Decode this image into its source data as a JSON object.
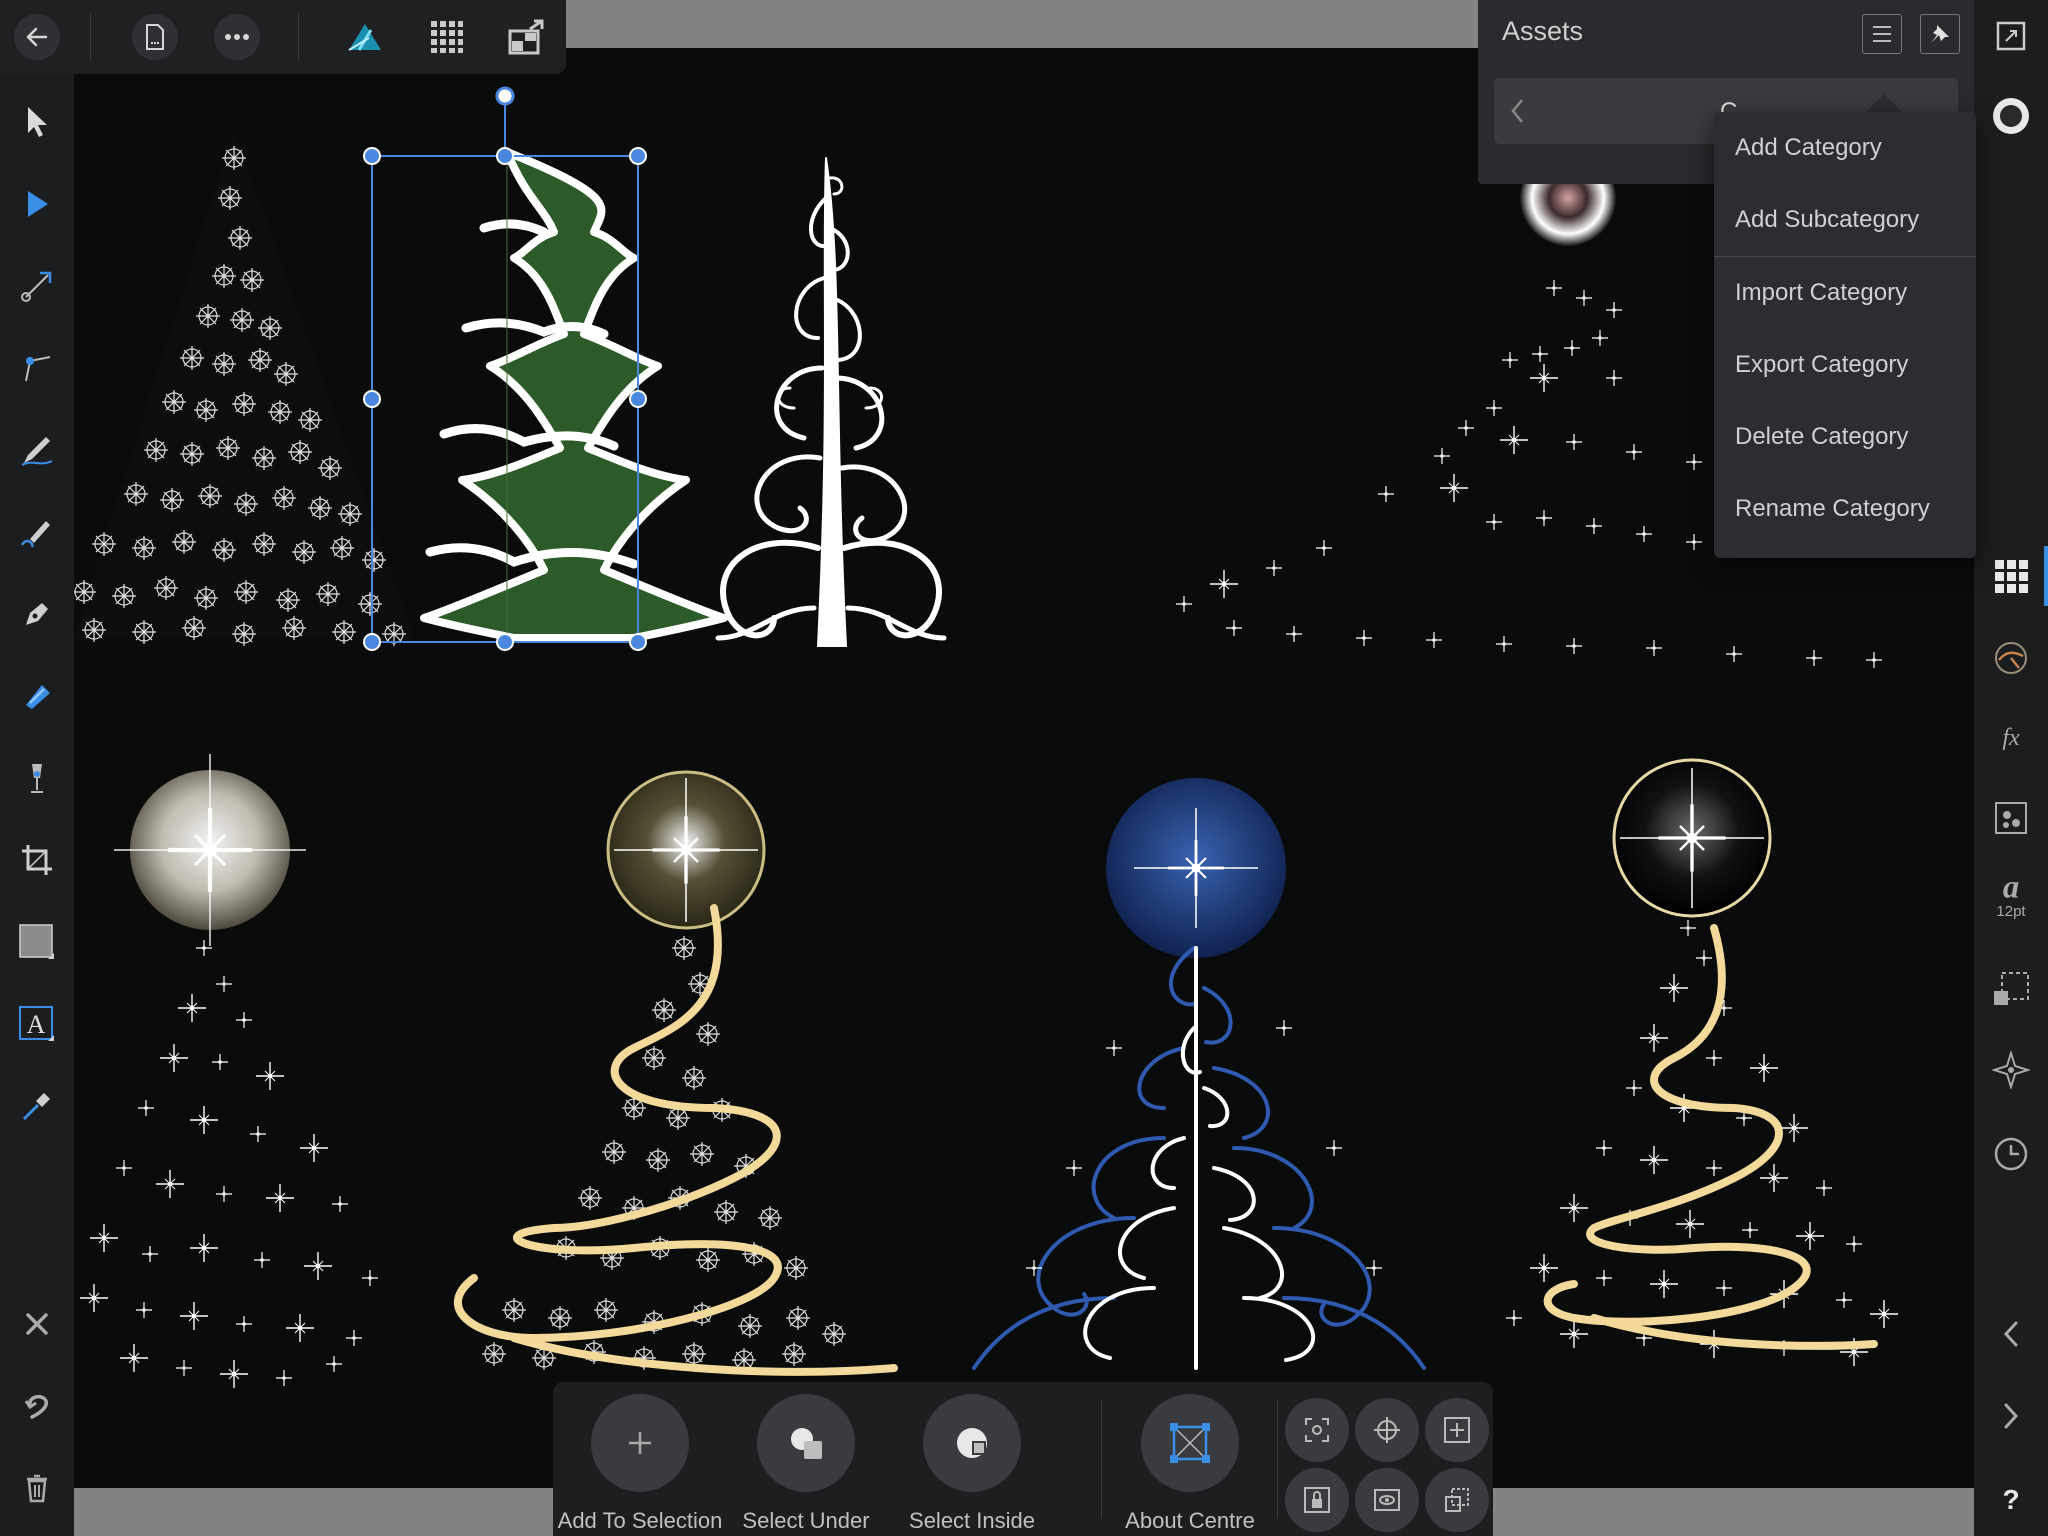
{
  "top_toolbar": {
    "back_icon": "back-arrow-icon",
    "document_icon": "document-icon",
    "more_icon": "more-icon",
    "persona_icon": "affinity-designer-persona-icon",
    "pixel_persona_icon": "pixel-persona-icon",
    "export_persona_icon": "export-persona-icon"
  },
  "assets_panel": {
    "title": "Assets",
    "category_label": "C",
    "menu_icon": "hamburger-icon",
    "pin_icon": "pin-icon",
    "prev_icon": "chevron-left-icon",
    "next_icon": "chevron-right-icon"
  },
  "dropdown_menu": {
    "items": [
      "Add Category",
      "Add Subcategory",
      "Import Category",
      "Export Category",
      "Delete Category",
      "Rename Category"
    ]
  },
  "context_toolbar": {
    "add_to_selection": "Add To Selection",
    "select_under": "Select Under",
    "select_inside": "Select Inside",
    "about_centre": "About Centre"
  },
  "right_toolbar": {
    "font_size": "12pt"
  },
  "colors": {
    "accent": "#3a7bd5",
    "selection": "#4a88e0",
    "ribbon_gold": "#f3d99a",
    "tree_green": "#2e5a2a",
    "orb_blue": "#173a7a",
    "panel_bg": "#2a2b2e"
  }
}
